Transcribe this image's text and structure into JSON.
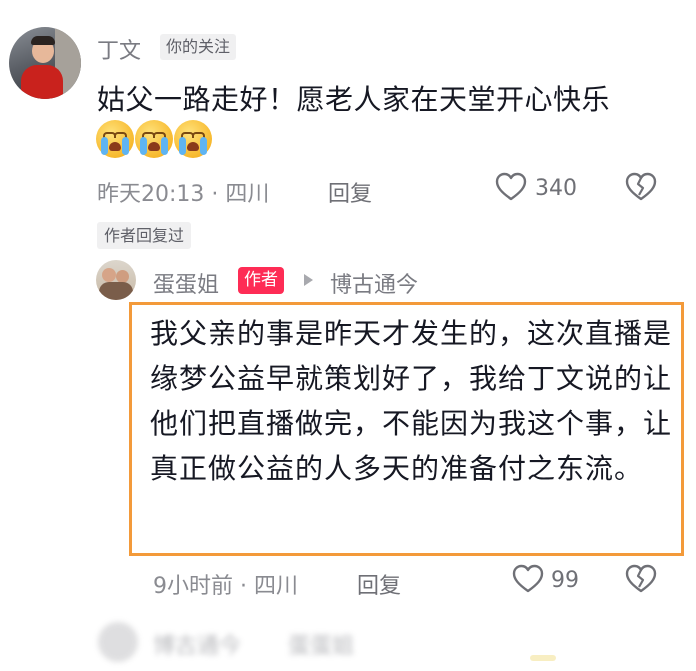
{
  "comment": {
    "username": "丁文",
    "follow_tag": "你的关注",
    "text": "姑父一路走好！愿老人家在天堂开心快乐",
    "emoji_icons": [
      "crying-face-icon",
      "crying-face-icon",
      "crying-face-icon"
    ],
    "meta": "昨天20:13 · 四川",
    "reply_label": "回复",
    "like_count": "340",
    "author_replied_tag": "作者回复过"
  },
  "reply": {
    "username": "蛋蛋姐",
    "author_badge": "作者",
    "reply_to": "博古通今",
    "text": "我父亲的事是昨天才发生的，这次直播是缘梦公益早就策划好了，我给丁文说的让他们把直播做完，不能因为我这个事，让真正做公益的人多天的准备付之东流。",
    "meta": "9小时前 · 四川",
    "reply_label": "回复",
    "like_count": "99"
  },
  "next_reply_blurred": {
    "name_a": "博古通今",
    "name_b": "蛋蛋姐"
  },
  "colors": {
    "highlight_border": "#f39a3a",
    "author_badge": "#fe2c55",
    "meta_text": "#8a8b91"
  }
}
